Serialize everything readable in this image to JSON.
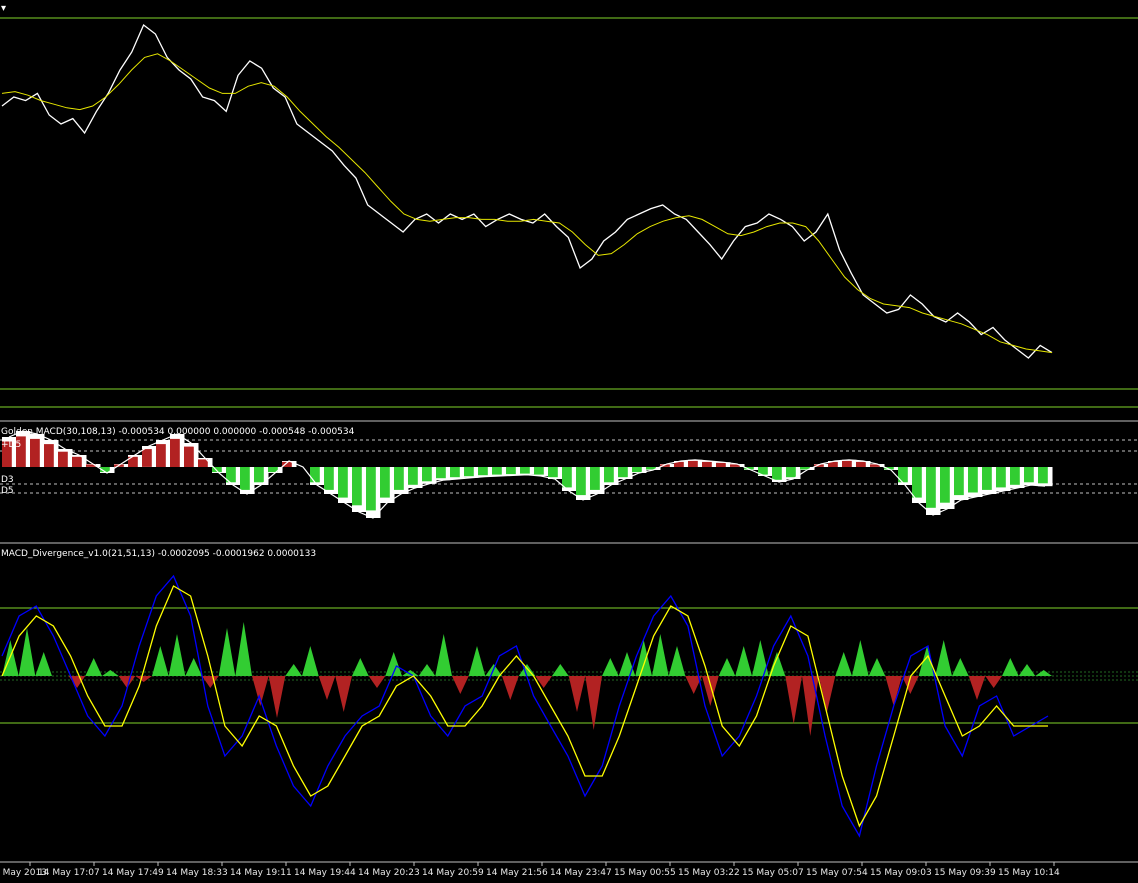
{
  "colors": {
    "background": "#000000",
    "price": "#ffffff",
    "ma": "#e6e600",
    "level": "#7fd32a",
    "separator": "#c0c0c0",
    "bull": "#32cd32",
    "bear": "#b22222",
    "macd_line": "#ffff00",
    "signal_line": "#0000ff",
    "up_arrow": "#228b22",
    "down_arrow": "#ff0000"
  },
  "panels": {
    "golden_macd_label": "Golden MACD(30,108,13) -0.000534 0.000000 0.000000 -0.000548 -0.000534",
    "golden_levels": [
      "+D5",
      "D3",
      "D5"
    ],
    "divergence_label": "MACD_Divergence_v1.0(21,51,13) -0.0002095 -0.0001962 0.0000133"
  },
  "chart_data": [
    {
      "type": "line",
      "panel": "price",
      "grid": false,
      "series": [
        {
          "values": [
            0.55,
            0.6,
            0.58,
            0.62,
            0.5,
            0.45,
            0.48,
            0.4,
            0.52,
            0.62,
            0.75,
            0.85,
            1.0,
            0.95,
            0.82,
            0.75,
            0.7,
            0.6,
            0.58,
            0.52,
            0.72,
            0.8,
            0.76,
            0.65,
            0.6,
            0.45,
            0.4,
            0.35,
            0.3,
            0.22,
            0.15,
            0.0,
            -0.05,
            -0.1,
            -0.15,
            -0.08,
            -0.05,
            -0.1,
            -0.05,
            -0.08,
            -0.05,
            -0.12,
            -0.08,
            -0.05,
            -0.08,
            -0.1,
            -0.05,
            -0.12,
            -0.18,
            -0.35,
            -0.3,
            -0.2,
            -0.15,
            -0.08,
            -0.05,
            -0.02,
            0.0,
            -0.05,
            -0.08,
            -0.15,
            -0.22,
            -0.3,
            -0.2,
            -0.12,
            -0.1,
            -0.05,
            -0.08,
            -0.12,
            -0.2,
            -0.15,
            -0.05,
            -0.25,
            -0.38,
            -0.5,
            -0.55,
            -0.6,
            -0.58,
            -0.5,
            -0.55,
            -0.62,
            -0.65,
            -0.6,
            -0.65,
            -0.72,
            -0.68,
            -0.75,
            -0.8,
            -0.85,
            -0.78,
            -0.82
          ]
        },
        {
          "values": [
            0.62,
            0.63,
            0.61,
            0.58,
            0.56,
            0.54,
            0.53,
            0.55,
            0.6,
            0.67,
            0.75,
            0.82,
            0.84,
            0.8,
            0.75,
            0.7,
            0.65,
            0.62,
            0.62,
            0.66,
            0.68,
            0.66,
            0.6,
            0.52,
            0.45,
            0.38,
            0.32,
            0.25,
            0.18,
            0.1,
            0.02,
            -0.05,
            -0.08,
            -0.09,
            -0.08,
            -0.07,
            -0.07,
            -0.08,
            -0.08,
            -0.09,
            -0.09,
            -0.08,
            -0.09,
            -0.1,
            -0.15,
            -0.22,
            -0.28,
            -0.27,
            -0.22,
            -0.16,
            -0.12,
            -0.09,
            -0.07,
            -0.06,
            -0.08,
            -0.12,
            -0.16,
            -0.17,
            -0.15,
            -0.12,
            -0.1,
            -0.1,
            -0.12,
            -0.2,
            -0.3,
            -0.4,
            -0.47,
            -0.52,
            -0.55,
            -0.56,
            -0.57,
            -0.6,
            -0.62,
            -0.64,
            -0.66,
            -0.69,
            -0.72,
            -0.76,
            -0.78,
            -0.8,
            -0.81,
            -0.82
          ]
        }
      ]
    },
    {
      "type": "bar",
      "panel": "golden_macd",
      "values": [
        0.5,
        0.6,
        0.55,
        0.45,
        0.3,
        0.2,
        0.05,
        -0.1,
        0.05,
        0.2,
        0.35,
        0.45,
        0.55,
        0.4,
        0.15,
        -0.1,
        -0.3,
        -0.45,
        -0.3,
        -0.1,
        0.1,
        0.0,
        -0.3,
        -0.45,
        -0.6,
        -0.75,
        -0.85,
        -0.6,
        -0.45,
        -0.35,
        -0.28,
        -0.22,
        -0.2,
        -0.18,
        -0.16,
        -0.15,
        -0.14,
        -0.13,
        -0.15,
        -0.2,
        -0.4,
        -0.55,
        -0.45,
        -0.3,
        -0.2,
        -0.1,
        -0.05,
        0.05,
        0.1,
        0.12,
        0.1,
        0.08,
        0.05,
        -0.05,
        -0.15,
        -0.25,
        -0.2,
        -0.05,
        0.05,
        0.1,
        0.12,
        0.1,
        0.05,
        -0.05,
        -0.3,
        -0.6,
        -0.8,
        -0.7,
        -0.55,
        -0.5,
        -0.45,
        -0.4,
        -0.35,
        -0.3,
        -0.32
      ]
    },
    {
      "type": "bar",
      "panel": "macd_divergence",
      "values": [
        0.6,
        0.8,
        0.4,
        0.0,
        -0.2,
        0.3,
        0.1,
        -0.2,
        -0.1,
        0.5,
        0.7,
        0.3,
        -0.2,
        0.8,
        0.9,
        -0.5,
        -0.7,
        0.2,
        0.5,
        -0.4,
        -0.6,
        0.3,
        -0.2,
        0.4,
        0.1,
        0.2,
        0.7,
        -0.3,
        0.5,
        0.2,
        -0.4,
        0.2,
        -0.2,
        0.2,
        -0.6,
        -0.9,
        0.3,
        0.4,
        0.6,
        0.7,
        0.5,
        -0.3,
        -0.5,
        0.3,
        0.5,
        0.6,
        0.4,
        -0.8,
        -1.0,
        -0.6,
        0.4,
        0.6,
        0.3,
        -0.5,
        -0.3,
        0.5,
        0.6,
        0.3,
        -0.4,
        -0.2,
        0.3,
        0.2,
        0.1
      ],
      "series": [
        {
          "values": [
            0.2,
            0.6,
            0.7,
            0.4,
            0.0,
            -0.4,
            -0.6,
            -0.3,
            0.3,
            0.8,
            1.0,
            0.6,
            -0.3,
            -0.8,
            -0.6,
            -0.2,
            -0.7,
            -1.1,
            -1.3,
            -0.9,
            -0.6,
            -0.4,
            -0.3,
            0.1,
            0.0,
            -0.4,
            -0.6,
            -0.3,
            -0.2,
            0.2,
            0.3,
            -0.2,
            -0.5,
            -0.8,
            -1.2,
            -0.9,
            -0.3,
            0.2,
            0.6,
            0.8,
            0.5,
            -0.3,
            -0.8,
            -0.6,
            -0.2,
            0.3,
            0.6,
            0.2,
            -0.6,
            -1.3,
            -1.6,
            -0.9,
            -0.3,
            0.2,
            0.3,
            -0.5,
            -0.8,
            -0.3,
            -0.2,
            -0.6,
            -0.5,
            -0.4
          ]
        },
        {
          "values": [
            0.0,
            0.4,
            0.6,
            0.5,
            0.2,
            -0.2,
            -0.5,
            -0.5,
            -0.1,
            0.5,
            0.9,
            0.8,
            0.2,
            -0.5,
            -0.7,
            -0.4,
            -0.5,
            -0.9,
            -1.2,
            -1.1,
            -0.8,
            -0.5,
            -0.4,
            -0.1,
            0.0,
            -0.2,
            -0.5,
            -0.5,
            -0.3,
            0.0,
            0.2,
            0.0,
            -0.3,
            -0.6,
            -1.0,
            -1.0,
            -0.6,
            -0.1,
            0.4,
            0.7,
            0.6,
            0.1,
            -0.5,
            -0.7,
            -0.4,
            0.1,
            0.5,
            0.4,
            -0.3,
            -1.0,
            -1.5,
            -1.2,
            -0.6,
            0.0,
            0.2,
            -0.2,
            -0.6,
            -0.5,
            -0.3,
            -0.5,
            -0.5,
            -0.5
          ]
        }
      ]
    }
  ],
  "x_axis": {
    "ticks": [
      "4 May 2013",
      "14 May 17:07",
      "14 May 17:49",
      "14 May 18:33",
      "14 May 19:11",
      "14 May 19:44",
      "14 May 20:23",
      "14 May 20:59",
      "14 May 21:56",
      "14 May 23:47",
      "15 May 00:55",
      "15 May 03:22",
      "15 May 05:07",
      "15 May 07:54",
      "15 May 09:03",
      "15 May 09:39",
      "15 May 10:14"
    ]
  }
}
